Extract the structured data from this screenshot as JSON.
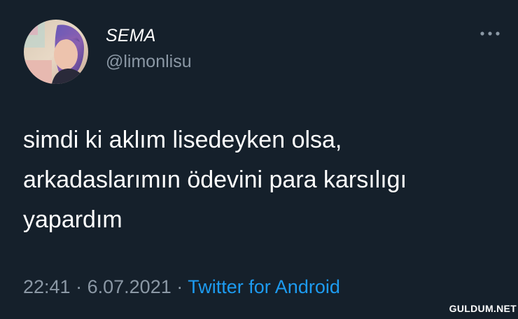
{
  "user": {
    "display_name": "SEMA",
    "handle": "@limonlisu"
  },
  "tweet": {
    "lines": [
      "simdi ki aklım lisedeyken olsa,",
      "arkadaslarımın ödevini para karsılıgı",
      "yapardım"
    ],
    "time": "22:41",
    "separator": "·",
    "date": "6.07.2021",
    "source": "Twitter for Android"
  },
  "icons": {
    "avatar": "profile-photo",
    "more": "more-horizontal-icon"
  },
  "watermark": "GULDUM.NET",
  "colors": {
    "background": "#15202b",
    "text_primary": "#ffffff",
    "text_secondary": "#8b98a5",
    "link": "#1d9bf0"
  }
}
